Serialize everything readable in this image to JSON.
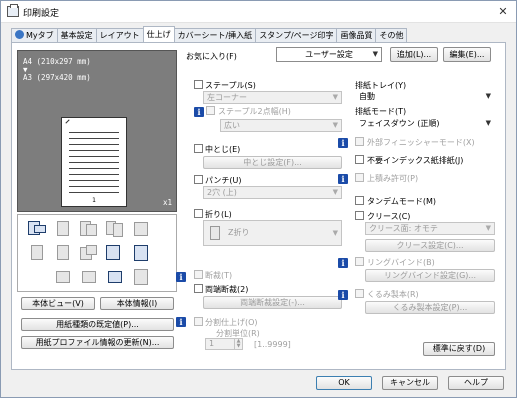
{
  "window": {
    "title": "印刷設定",
    "close_glyph": "✕"
  },
  "tabs": [
    {
      "label": "Myタブ"
    },
    {
      "label": "基本設定"
    },
    {
      "label": "レイアウト"
    },
    {
      "label": "仕上げ"
    },
    {
      "label": "カバーシート/挿入紙"
    },
    {
      "label": "スタンプ/ページ印字"
    },
    {
      "label": "画像品質"
    },
    {
      "label": "その他"
    }
  ],
  "preview": {
    "paper_line1": "A4 (210x297 mm)",
    "arrow": "▼",
    "paper_line2": "A3 (297x420 mm)",
    "page_number": "1",
    "copies": "x1"
  },
  "left_buttons": {
    "main_view": "本体ビュー(V)",
    "main_info": "本体情報(I)",
    "paper_default": "用紙種類の既定値(P)...",
    "paper_profile_update": "用紙プロファイル情報の更新(N)..."
  },
  "favorites": {
    "label": "お気に入り(F)",
    "value": "ユーザー設定",
    "add_button": "追加(L)...",
    "edit_button": "編集(E)..."
  },
  "staple": {
    "label": "ステープル(S)",
    "position_value": "左コーナー",
    "two_point_label": "ステープル2点幅(H)",
    "width_value": "広い"
  },
  "center_fold": {
    "label": "中とじ(E)",
    "settings_button": "中とじ設定(F)..."
  },
  "punch": {
    "label": "パンチ(U)",
    "value": "2穴 (上)"
  },
  "fold": {
    "label": "折り(L)",
    "value": "Z折り",
    "separate_label": "断裁(T)",
    "both_sides_label": "両端断裁(2)",
    "both_sides_button": "両端断裁設定(-)..."
  },
  "split_finish": {
    "label": "分割仕上げ(O)",
    "unit_label": "分割単位(R)",
    "unit_value": "1",
    "range_label": "[1..9999]"
  },
  "output": {
    "tray_label": "排紙トレイ(Y)",
    "tray_value": "自動",
    "mode_label": "排紙モード(T)",
    "mode_value": "フェイスダウン (正順)"
  },
  "options": {
    "external_finisher": "外部フィニッシャーモード(X)",
    "index_discharge": "不要インデックス紙排紙(J)",
    "stack_allow": "上積み許可(P)",
    "tandem": "タンデムモード(M)",
    "crease_label": "クリース(C)",
    "crease_value": "クリース面: オモテ",
    "crease_button": "クリース設定(C)...",
    "ring_binder": "リングバインド(B)",
    "ring_binder_button": "リングバインド設定(G)...",
    "wrap_bind": "くるみ製本(R)",
    "wrap_bind_button": "くるみ製本設定(P)..."
  },
  "reset_button": "標準に戻す(D)",
  "footer": {
    "ok": "OK",
    "cancel": "キャンセル",
    "help": "ヘルプ"
  },
  "colors": {
    "tab_active": "#ffffff",
    "panel_bg": "#f0f0f0",
    "preview_bg": "#7d7d7d",
    "info_icon": "#1b4ba8"
  }
}
